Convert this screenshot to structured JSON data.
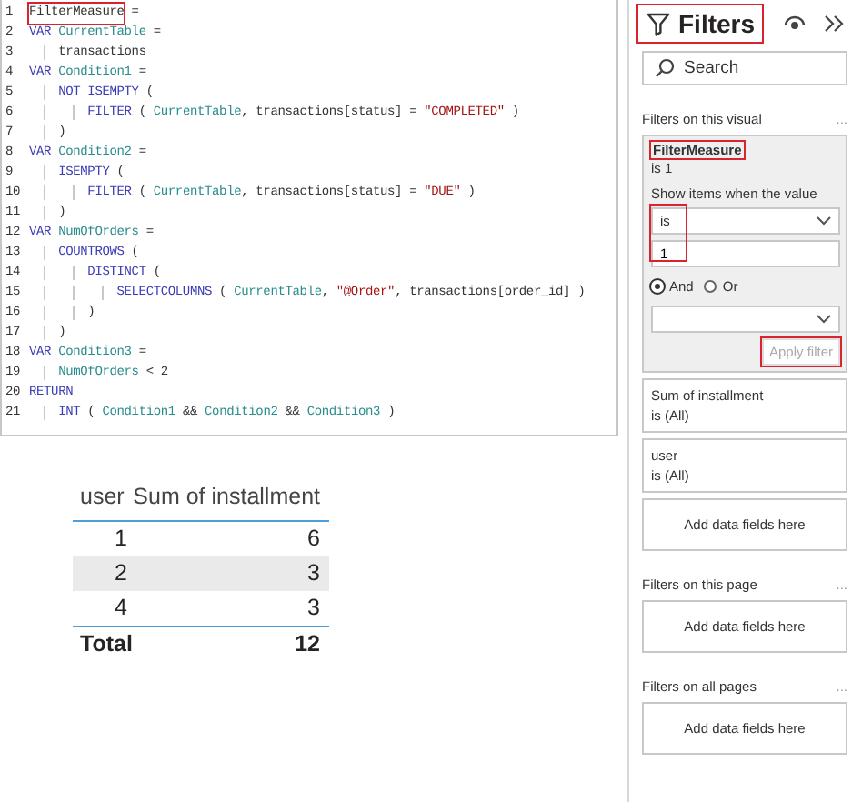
{
  "code_editor": {
    "lines": [
      {
        "number": "1",
        "segments": [
          {
            "text": "FilterMeasure",
            "kind": "plain",
            "highlighted": true
          },
          {
            "text": " =",
            "kind": "plain"
          }
        ]
      },
      {
        "number": "2",
        "segments": [
          {
            "text": "VAR ",
            "kind": "keyword"
          },
          {
            "text": "CurrentTable",
            "kind": "variable"
          },
          {
            "text": " =",
            "kind": "plain"
          }
        ]
      },
      {
        "number": "3",
        "segments": [
          {
            "text": "    transactions",
            "kind": "plain"
          }
        ]
      },
      {
        "number": "4",
        "segments": [
          {
            "text": "VAR ",
            "kind": "keyword"
          },
          {
            "text": "Condition1",
            "kind": "variable"
          },
          {
            "text": " =",
            "kind": "plain"
          }
        ]
      },
      {
        "number": "5",
        "segments": [
          {
            "text": "    NOT ISEMPTY",
            "kind": "keyword"
          },
          {
            "text": " (",
            "kind": "plain"
          }
        ]
      },
      {
        "number": "6",
        "segments": [
          {
            "text": "        FILTER",
            "kind": "keyword"
          },
          {
            "text": " ( ",
            "kind": "plain"
          },
          {
            "text": "CurrentTable",
            "kind": "variable"
          },
          {
            "text": ", transactions[status] = ",
            "kind": "plain"
          },
          {
            "text": "\"COMPLETED\"",
            "kind": "string"
          },
          {
            "text": " )",
            "kind": "plain"
          }
        ]
      },
      {
        "number": "7",
        "segments": [
          {
            "text": "    )",
            "kind": "plain"
          }
        ]
      },
      {
        "number": "8",
        "segments": [
          {
            "text": "VAR ",
            "kind": "keyword"
          },
          {
            "text": "Condition2",
            "kind": "variable"
          },
          {
            "text": " =",
            "kind": "plain"
          }
        ]
      },
      {
        "number": "9",
        "segments": [
          {
            "text": "    ISEMPTY",
            "kind": "keyword"
          },
          {
            "text": " (",
            "kind": "plain"
          }
        ]
      },
      {
        "number": "10",
        "segments": [
          {
            "text": "        FILTER",
            "kind": "keyword"
          },
          {
            "text": " ( ",
            "kind": "plain"
          },
          {
            "text": "CurrentTable",
            "kind": "variable"
          },
          {
            "text": ", transactions[status] = ",
            "kind": "plain"
          },
          {
            "text": "\"DUE\"",
            "kind": "string"
          },
          {
            "text": " )",
            "kind": "plain"
          }
        ]
      },
      {
        "number": "11",
        "segments": [
          {
            "text": "    )",
            "kind": "plain"
          }
        ]
      },
      {
        "number": "12",
        "segments": [
          {
            "text": "VAR ",
            "kind": "keyword"
          },
          {
            "text": "NumOfOrders",
            "kind": "variable"
          },
          {
            "text": " =",
            "kind": "plain"
          }
        ]
      },
      {
        "number": "13",
        "segments": [
          {
            "text": "    COUNTROWS",
            "kind": "keyword"
          },
          {
            "text": " (",
            "kind": "plain"
          }
        ]
      },
      {
        "number": "14",
        "segments": [
          {
            "text": "        DISTINCT",
            "kind": "keyword"
          },
          {
            "text": " (",
            "kind": "plain"
          }
        ]
      },
      {
        "number": "15",
        "segments": [
          {
            "text": "            SELECTCOLUMNS",
            "kind": "keyword"
          },
          {
            "text": " ( ",
            "kind": "plain"
          },
          {
            "text": "CurrentTable",
            "kind": "variable"
          },
          {
            "text": ", ",
            "kind": "plain"
          },
          {
            "text": "\"@Order\"",
            "kind": "string"
          },
          {
            "text": ", transactions[order_id] )",
            "kind": "plain"
          }
        ]
      },
      {
        "number": "16",
        "segments": [
          {
            "text": "        )",
            "kind": "plain"
          }
        ]
      },
      {
        "number": "17",
        "segments": [
          {
            "text": "    )",
            "kind": "plain"
          }
        ]
      },
      {
        "number": "18",
        "segments": [
          {
            "text": "VAR ",
            "kind": "keyword"
          },
          {
            "text": "Condition3",
            "kind": "variable"
          },
          {
            "text": " =",
            "kind": "plain"
          }
        ]
      },
      {
        "number": "19",
        "segments": [
          {
            "text": "    NumOfOrders",
            "kind": "variable"
          },
          {
            "text": " < 2",
            "kind": "plain"
          }
        ]
      },
      {
        "number": "20",
        "segments": [
          {
            "text": "RETURN",
            "kind": "keyword"
          }
        ]
      },
      {
        "number": "21",
        "segments": [
          {
            "text": "    INT",
            "kind": "keyword"
          },
          {
            "text": " ( ",
            "kind": "plain"
          },
          {
            "text": "Condition1",
            "kind": "variable"
          },
          {
            "text": " && ",
            "kind": "plain"
          },
          {
            "text": "Condition2",
            "kind": "variable"
          },
          {
            "text": " && ",
            "kind": "plain"
          },
          {
            "text": "Condition3",
            "kind": "variable"
          },
          {
            "text": " )",
            "kind": "plain"
          }
        ]
      }
    ]
  },
  "table": {
    "columns": [
      "user",
      "Sum of installment"
    ],
    "rows": [
      [
        "1",
        "6"
      ],
      [
        "2",
        "3"
      ],
      [
        "4",
        "3"
      ]
    ],
    "total": [
      "Total",
      "12"
    ]
  },
  "filters_pane": {
    "title": "Filters",
    "title_highlighted": true,
    "search": {
      "placeholder": "Search"
    },
    "sections": [
      {
        "title": "Filters on this visual",
        "more": "...",
        "cards": [
          {
            "kind": "expanded",
            "field": "FilterMeasure",
            "field_highlighted": true,
            "summary": "is 1",
            "prompt": "Show items when the value",
            "condition": {
              "operator": "is",
              "value": "1",
              "highlighted": true
            },
            "logic": [
              {
                "label": "And",
                "selected": true
              },
              {
                "label": "Or",
                "selected": false
              }
            ],
            "apply": {
              "label": "Apply filter",
              "disabled": true,
              "highlighted": true
            }
          },
          {
            "kind": "filter",
            "field": "Sum of installment",
            "summary": "is (All)"
          },
          {
            "kind": "filter",
            "field": "user",
            "summary": "is (All)"
          },
          {
            "kind": "add",
            "label": "Add data fields here"
          }
        ]
      },
      {
        "title": "Filters on this page",
        "more": "...",
        "cards": [
          {
            "kind": "add",
            "label": "Add data fields here"
          }
        ]
      },
      {
        "title": "Filters on all pages",
        "more": "...",
        "cards": [
          {
            "kind": "add",
            "label": "Add data fields here"
          }
        ]
      }
    ]
  }
}
